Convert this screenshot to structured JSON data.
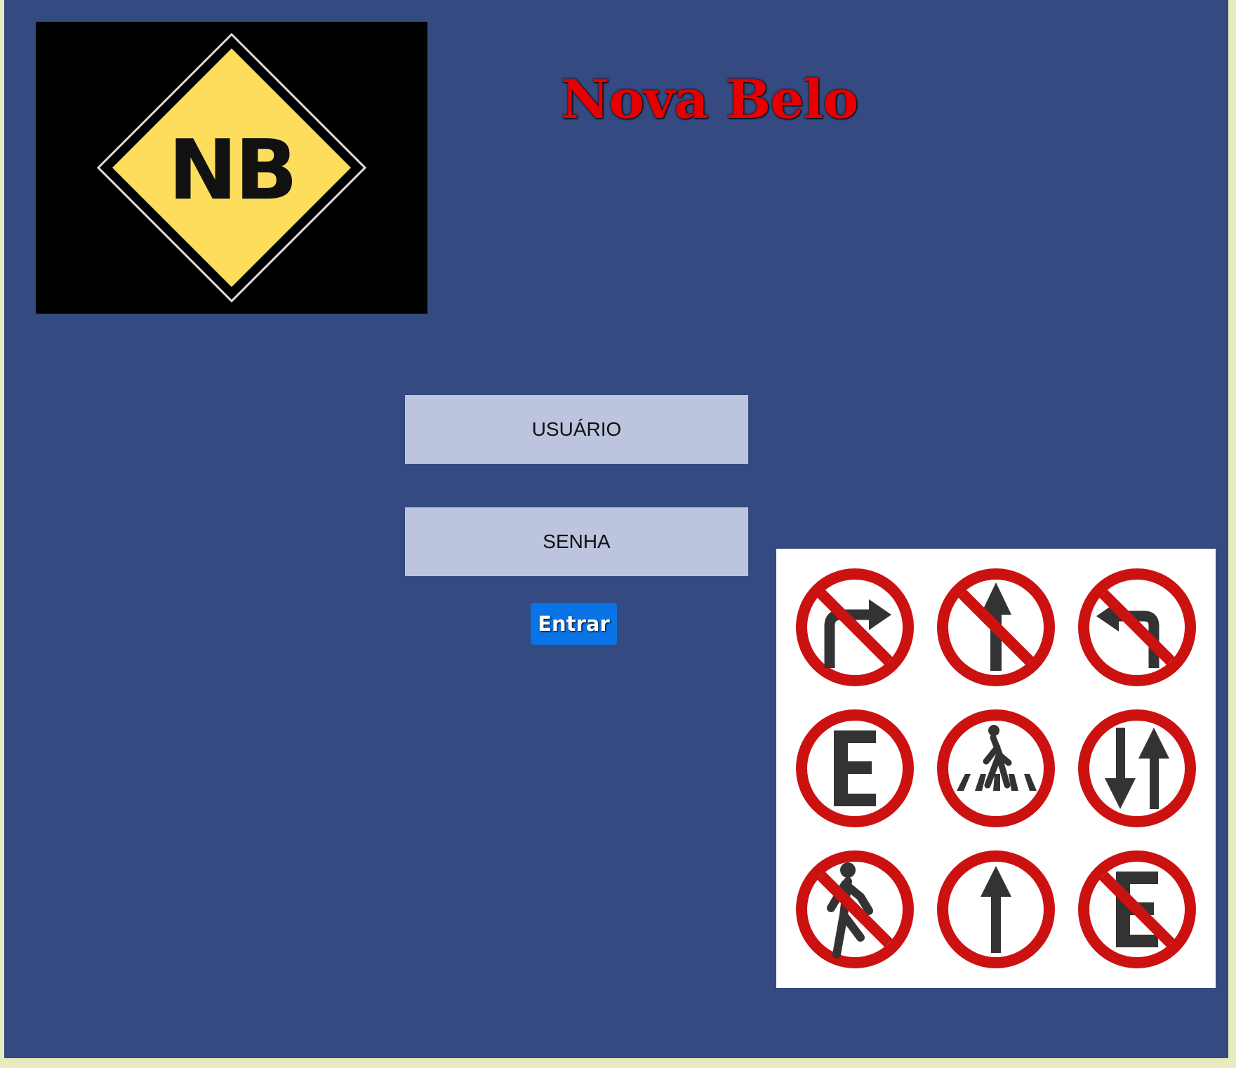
{
  "app": {
    "title": "Nova Belo"
  },
  "logo": {
    "text": "NB",
    "icon": "diamond-road-sign-icon",
    "colors": {
      "background": "#000000",
      "sign": "#fddd5c",
      "text": "#111111"
    }
  },
  "login": {
    "username_placeholder": "USUÁRIO",
    "password_placeholder": "SENHA",
    "submit_label": "Entrar"
  },
  "signs_image": {
    "icons": [
      "no-right-turn-sign-icon",
      "no-straight-ahead-sign-icon",
      "no-left-turn-sign-icon",
      "parking-sign-icon",
      "pedestrian-crossing-sign-icon",
      "two-way-traffic-sign-icon",
      "no-pedestrians-sign-icon",
      "straight-ahead-only-sign-icon",
      "no-parking-sign-icon"
    ]
  },
  "colors": {
    "page_background": "#e8ebbf",
    "panel": "#344a80",
    "title": "#e60000",
    "field": "#bcc4de",
    "button": "#0a73e6",
    "sign_red": "#cc1111",
    "sign_symbol": "#333333"
  }
}
